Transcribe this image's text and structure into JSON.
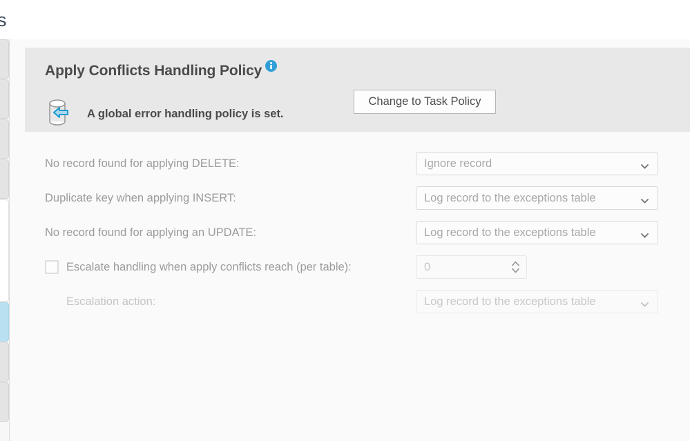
{
  "page": {
    "title_visible_fragment": "ngs",
    "background_color": "#fafafa"
  },
  "tab_strip": {
    "selected_color": "#b8e0f0",
    "tabs": [
      {
        "name": "tab-1",
        "state": "normal"
      },
      {
        "name": "tab-2",
        "state": "normal"
      },
      {
        "name": "tab-3",
        "state": "normal"
      },
      {
        "name": "tab-4",
        "state": "normal"
      },
      {
        "name": "tab-5",
        "state": "current"
      },
      {
        "name": "tab-6",
        "state": "selected"
      },
      {
        "name": "tab-7",
        "state": "normal"
      },
      {
        "name": "tab-8",
        "state": "normal"
      }
    ]
  },
  "policy_header": {
    "title": "Apply Conflicts Handling Policy",
    "info_icon": "info-icon",
    "info_icon_color": "#2f9fd8",
    "database_icon": "database-arrow-icon",
    "arrow_color": "#1b9ad1",
    "status_text": "A global error handling policy is set.",
    "button_label": "Change to Task Policy",
    "band_color": "#e8e8e8"
  },
  "form": {
    "rows": [
      {
        "label": "No record found for applying DELETE:",
        "control": "dropdown",
        "value": "Ignore record",
        "disabled": false
      },
      {
        "label": "Duplicate key when applying INSERT:",
        "control": "dropdown",
        "value": "Log record to the exceptions table",
        "disabled": false
      },
      {
        "label": "No record found for applying an UPDATE:",
        "control": "dropdown",
        "value": "Log record to the exceptions table",
        "disabled": false
      }
    ],
    "escalate": {
      "checkbox_label": "Escalate handling when apply conflicts reach (per table):",
      "checked": false,
      "spinner_value": "0"
    },
    "escalation_action": {
      "label": "Escalation action:",
      "value": "Log record to the exceptions table",
      "disabled": true
    }
  }
}
